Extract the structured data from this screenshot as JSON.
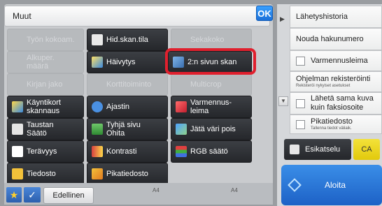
{
  "header": {
    "title": "Muut",
    "ok_label": "OK"
  },
  "buttons": {
    "job_build": "Työn kokoam.",
    "hid_scan_status": "Hid.skan.tila",
    "mixed_size": "Sekakoko",
    "original_count": "Alkuper.\nmäärä",
    "fade": "Häivytys",
    "two_page_scan": "2:n sivun skan",
    "book_divide": "Kirjan jako",
    "card_shot": "Korttitoiminto",
    "multicrop": "Multicrop",
    "card_scan": "Käyntikort\nskannaus",
    "timer": "Ajastin",
    "verification_stamp": "Varmennus-\nleima",
    "background_adjust": "Taustan\nSäätö",
    "blank_page_skip": "Tyhjä sivu\nOhita",
    "color_drop": "Jätä väri pois",
    "sharpness": "Terävyys",
    "contrast": "Kontrasti",
    "rgb_adjust": "RGB säätö",
    "file": "Tiedosto",
    "quick_file": "Pikatiedosto"
  },
  "bottom": {
    "previous_label": "Edellinen",
    "tray_left": "A4",
    "tray_right": "A4"
  },
  "right_panel": {
    "send_history": "Lähetyshistoria",
    "address_recall": "Nouda hakunumero",
    "verification_stamp": "Varmennusleima",
    "program_register": "Ohjelman rekisteröinti",
    "program_register_sub": "Rekisteröi nykyiset asetukset",
    "send_same_as_fax": "Lähetä sama kuva\nkuin faksiosoite",
    "quick_file": "Pikatiedosto",
    "quick_file_sub": "Tallenna tiedot väliaik.",
    "preview": "Esikatselu",
    "ca": "CA",
    "start": "Aloita"
  },
  "colors": {
    "highlight": "#e0202e",
    "start": "#1d61c6",
    "ca": "#f3e23a"
  }
}
